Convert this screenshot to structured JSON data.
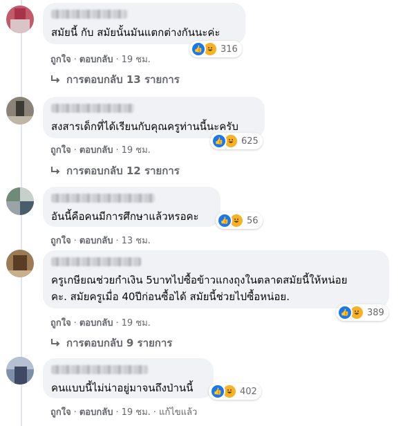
{
  "labels": {
    "like": "ถูกใจ",
    "reply": "ตอบกลับ",
    "dot": "·",
    "edited": "แก้ไขแล้ว"
  },
  "comments": [
    {
      "text_lines": [
        "สมัยนี้ กับ สมัยนั้นมันแตกต่างกันนะค่ะ"
      ],
      "reactions_count": "316",
      "time": "19 ชม.",
      "replies_label": "การตอบกลับ 13 รายการ"
    },
    {
      "text_lines": [
        "สงสารเด็กที่ได้เรียนกับคุณครูท่านนี้นะครับ"
      ],
      "reactions_count": "625",
      "time": "19 ชม.",
      "replies_label": "การตอบกลับ 12 รายการ"
    },
    {
      "text_lines": [
        "อันนี้คือคนมีการศึกษาแล้วหรอคะ"
      ],
      "reactions_count": "56",
      "time": "13 ชม."
    },
    {
      "text_lines": [
        "ครูเกษียณช่วยกำเงิน 5บาทไปซื้อข้าวแกงถุงในตลาดสมัยนี้ให้หน่อย",
        "คะ. สมัยครูเมื่อ 40ปีก่อนซื้อได้ สมัยนี้ช่วยไปซื้อหน่อย."
      ],
      "reactions_count": "389",
      "time": "19 ชม.",
      "replies_label": "การตอบกลับ 9 รายการ"
    },
    {
      "text_lines": [
        "คนแบบนี้ไม่น่าอยู่มาจนถึงป่านนี้"
      ],
      "reactions_count": "402",
      "time": "19 ชม."
    }
  ],
  "colors": {
    "bubble": "#f0f2f5",
    "meta": "#65676b",
    "like_blue": "#1877f2",
    "haha_yellow": "#f7b125"
  }
}
